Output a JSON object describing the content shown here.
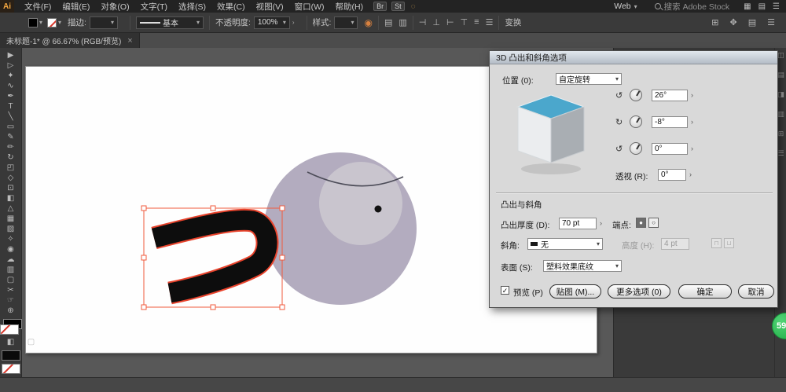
{
  "menubar": {
    "logo": "Ai",
    "items": [
      "文件(F)",
      "编辑(E)",
      "对象(O)",
      "文字(T)",
      "选择(S)",
      "效果(C)",
      "视图(V)",
      "窗口(W)",
      "帮助(H)"
    ],
    "bridge": "Br",
    "stock": "St",
    "workspace": "Web",
    "search_placeholder": "搜索 Adobe Stock"
  },
  "controlbar": {
    "stroke_label": "描边:",
    "brush_name": "基本",
    "opacity_label": "不透明度:",
    "opacity_value": "100%",
    "style_label": "样式:",
    "transform_label": "变换"
  },
  "doc_tab": {
    "title": "未标题-1* @ 66.67% (RGB/预览)"
  },
  "dialog": {
    "title": "3D 凸出和斜角选项",
    "position_label": "位置 (0):",
    "position_value": "自定旋转",
    "rotate_x_value": "26°",
    "rotate_y_value": "-8°",
    "rotate_z_value": "0°",
    "perspective_label": "透视 (R):",
    "perspective_value": "0°",
    "section_extrude": "凸出与斜角",
    "depth_label": "凸出厚度 (D):",
    "depth_value": "70 pt",
    "cap_label": "端点:",
    "bevel_label": "斜角:",
    "bevel_value": "无",
    "bevel_height_label": "高度 (H):",
    "bevel_height_value": "4 pt",
    "surface_label": "表面 (S):",
    "surface_value": "塑料效果底纹",
    "preview_label": "预览 (P)",
    "buttons": {
      "map": "贴图 (M)...",
      "more": "更多选项 (0)",
      "ok": "确定",
      "cancel": "取消"
    }
  },
  "badge": {
    "value": "59"
  },
  "icons": {
    "chevron_down": "▾",
    "submenu": "›",
    "close": "×",
    "check": "✓",
    "cap_solid": "●",
    "cap_hollow": "○",
    "rotate_x": "↺",
    "rotate_y": "↻",
    "rotate_z": "↺",
    "bevel_out": "⊓",
    "bevel_in": "⊔"
  },
  "menubar_right_icons": [
    {
      "name": "grid-view-icon",
      "glyph": "▦"
    },
    {
      "name": "panel-layout-icon",
      "glyph": "▤"
    },
    {
      "name": "menu-icon",
      "glyph": "☰"
    }
  ],
  "align_icons": [
    {
      "name": "align-left-icon",
      "glyph": "⊣"
    },
    {
      "name": "align-center-icon",
      "glyph": "⊥"
    },
    {
      "name": "align-right-icon",
      "glyph": "⊢"
    },
    {
      "name": "align-top-icon",
      "glyph": "⊤"
    },
    {
      "name": "distribute-icon",
      "glyph": "≡"
    },
    {
      "name": "align-more-icon",
      "glyph": "☰"
    }
  ],
  "controlbar_right_icons": [
    {
      "name": "arrange-icon",
      "glyph": "⊞"
    },
    {
      "name": "move-icon",
      "glyph": "✥"
    },
    {
      "name": "panel-options-icon",
      "glyph": "▤"
    },
    {
      "name": "workspace-menu-icon",
      "glyph": "☰"
    }
  ],
  "doc_icons": [
    {
      "name": "document-setup-icon",
      "glyph": "▤"
    },
    {
      "name": "preferences-icon",
      "glyph": "▥"
    }
  ],
  "dock_icons": [
    {
      "name": "collapsed-panel-icon",
      "glyph": "◫"
    },
    {
      "name": "collapsed-panel-icon",
      "glyph": "▤"
    },
    {
      "name": "collapsed-panel-icon",
      "glyph": "◨"
    },
    {
      "name": "collapsed-panel-icon",
      "glyph": "▥"
    },
    {
      "name": "collapsed-panel-icon",
      "glyph": "⊞"
    },
    {
      "name": "collapsed-panel-icon",
      "glyph": "☰"
    }
  ],
  "tools": [
    {
      "name": "selection-tool",
      "glyph": "▶"
    },
    {
      "name": "direct-selection-tool",
      "glyph": "▷"
    },
    {
      "name": "magic-wand-tool",
      "glyph": "✦"
    },
    {
      "name": "lasso-tool",
      "glyph": "∿"
    },
    {
      "name": "pen-tool",
      "glyph": "✒"
    },
    {
      "name": "type-tool",
      "glyph": "T"
    },
    {
      "name": "line-segment-tool",
      "glyph": "╲"
    },
    {
      "name": "rectangle-tool",
      "glyph": "▭"
    },
    {
      "name": "paintbrush-tool",
      "glyph": "✎"
    },
    {
      "name": "pencil-tool",
      "glyph": "✏"
    },
    {
      "name": "rotate-tool",
      "glyph": "↻"
    },
    {
      "name": "scale-tool",
      "glyph": "◰"
    },
    {
      "name": "width-tool",
      "glyph": "◇"
    },
    {
      "name": "free-transform-tool",
      "glyph": "⊡"
    },
    {
      "name": "shape-builder-tool",
      "glyph": "◧"
    },
    {
      "name": "perspective-grid-tool",
      "glyph": "△"
    },
    {
      "name": "mesh-tool",
      "glyph": "▦"
    },
    {
      "name": "gradient-tool",
      "glyph": "▨"
    },
    {
      "name": "eyedropper-tool",
      "glyph": "✧"
    },
    {
      "name": "blend-tool",
      "glyph": "◉"
    },
    {
      "name": "symbol-sprayer-tool",
      "glyph": "☁"
    },
    {
      "name": "column-graph-tool",
      "glyph": "▥"
    },
    {
      "name": "artboard-tool",
      "glyph": "▢"
    },
    {
      "name": "slice-tool",
      "glyph": "✂"
    },
    {
      "name": "hand-tool",
      "glyph": "☞"
    },
    {
      "name": "zoom-tool",
      "glyph": "⊕"
    }
  ],
  "colors": {
    "head_fill": "#b3acbf",
    "face_fill": "#c9c5ce",
    "selection_red": "#e8432c",
    "object_black": "#0d0d0d",
    "cube_top": "#4ba7cc",
    "cube_front": "#ebedef",
    "cube_side": "#a9aeb3"
  }
}
